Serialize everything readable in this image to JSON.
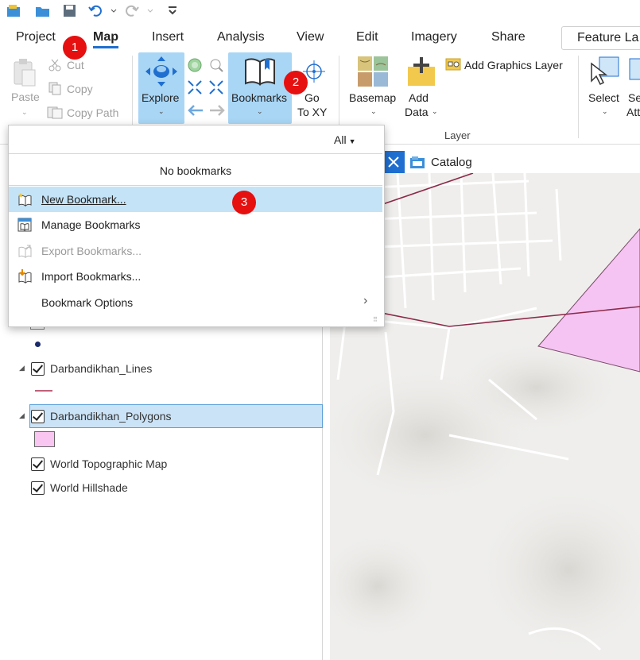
{
  "ribbon_tabs": [
    {
      "label": "Project"
    },
    {
      "label": "Map"
    },
    {
      "label": "Insert"
    },
    {
      "label": "Analysis"
    },
    {
      "label": "View"
    },
    {
      "label": "Edit"
    },
    {
      "label": "Imagery"
    },
    {
      "label": "Share"
    }
  ],
  "feature_tab_label": "Feature La",
  "clipboard": {
    "paste": "Paste",
    "cut": "Cut",
    "copy": "Copy",
    "copy_path": "Copy Path"
  },
  "navigate": {
    "explore": "Explore",
    "bookmarks": "Bookmarks",
    "go_to_xy_1": "Go",
    "go_to_xy_2": "To XY"
  },
  "layer_group": {
    "basemap": "Basemap",
    "add_data_1": "Add",
    "add_data_2": "Data",
    "add_graphics_layer": "Add Graphics Layer",
    "group_label": "Layer"
  },
  "selection": {
    "select": "Select",
    "select_by_attr_1": "Se",
    "select_by_attr_2": "Att"
  },
  "map_tabs": {
    "catalog": "Catalog"
  },
  "bookmarks_menu": {
    "filter_value": "All",
    "empty_text": "No bookmarks",
    "items": [
      {
        "label": "New Bookmark...",
        "icon": "new-bookmark-icon",
        "enabled": true,
        "selected": true
      },
      {
        "label": "Manage Bookmarks",
        "icon": "manage-bookmarks-icon",
        "enabled": true
      },
      {
        "label": "Export Bookmarks...",
        "icon": "export-bookmarks-icon",
        "enabled": false
      },
      {
        "label": "Import Bookmarks...",
        "icon": "import-bookmarks-icon",
        "enabled": true
      },
      {
        "label": "Bookmark Options",
        "icon": "",
        "enabled": true,
        "submenu": true
      }
    ]
  },
  "annotations": {
    "step1": "1",
    "step2": "2",
    "step3": "3"
  },
  "contents": {
    "layers": [
      {
        "name": "Darbandikhan_Lines",
        "checked": true,
        "swatch_color": "#c0607a"
      },
      {
        "name": "Darbandikhan_Polygons",
        "checked": true,
        "swatch_color": "#f8c6f0",
        "selected": true
      },
      {
        "name": "World Topographic Map",
        "checked": true
      },
      {
        "name": "World Hillshade",
        "checked": true
      }
    ]
  },
  "colors": {
    "accent": "#1f6fd0",
    "highlight": "#a9d6f5",
    "polygon_fill": "#f5c4f2",
    "line_color": "#8b2a4a",
    "badge": "#e61010"
  }
}
